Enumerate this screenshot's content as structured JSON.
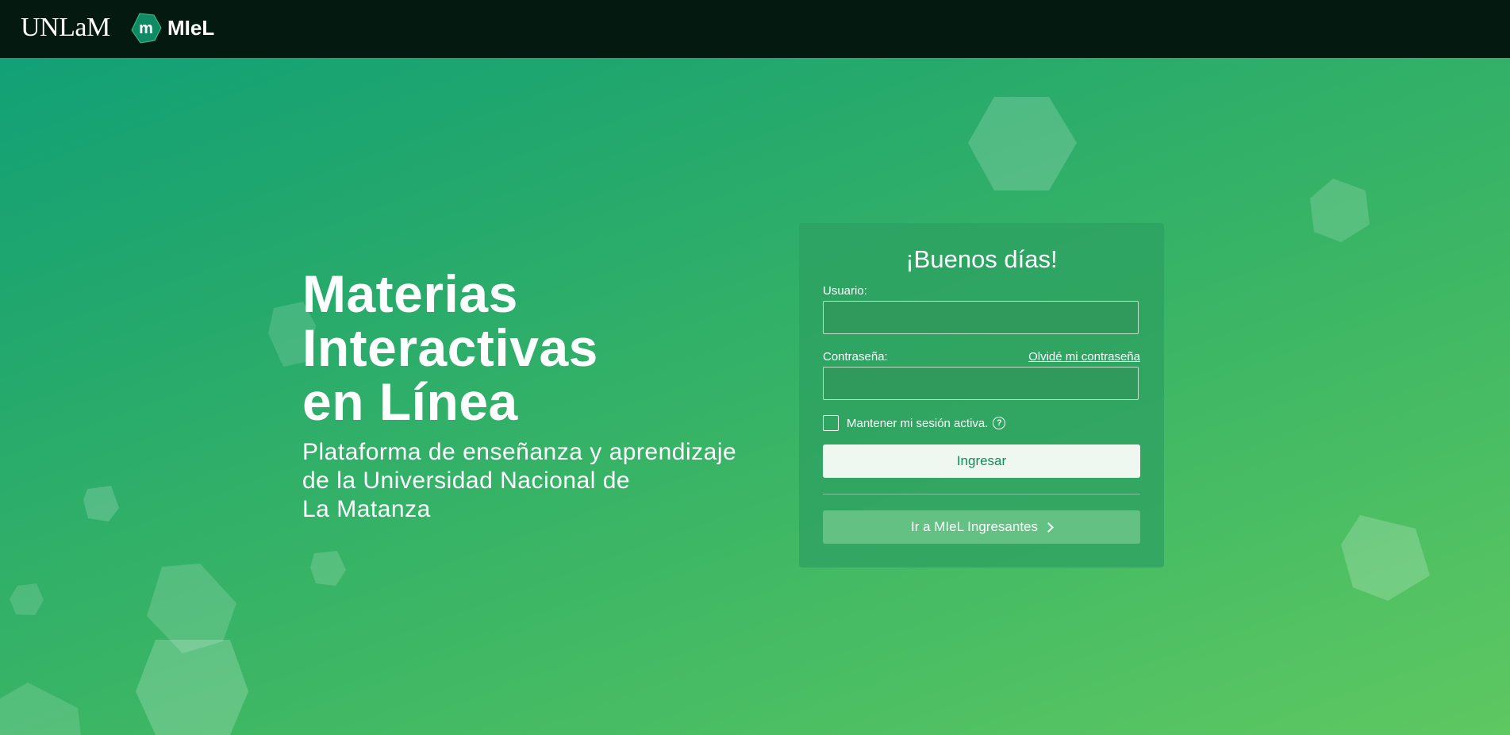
{
  "header": {
    "unlam_logo_text": "UNLaM",
    "miel_mark_letter": "m",
    "miel_text": "MIeL"
  },
  "hero": {
    "title_line1": "Materias",
    "title_line2": "Interactivas",
    "title_line3": "en Línea",
    "subtitle_line1": "Plataforma de enseñanza y aprendizaje",
    "subtitle_line2": "de la Universidad Nacional de",
    "subtitle_line3": "La Matanza"
  },
  "login": {
    "greeting": "¡Buenos días!",
    "username_label": "Usuario:",
    "username_value": "",
    "password_label": "Contraseña:",
    "password_value": "",
    "forgot_link": "Olvidé mi contraseña",
    "remember_label": "Mantener mi sesión activa.",
    "remember_checked": false,
    "help_icon": "?",
    "submit_label": "Ingresar",
    "ingresantes_label": "Ir a MIeL Ingresantes"
  },
  "colors": {
    "topbar": "#041a10",
    "gradient_start": "#0e9f78",
    "gradient_end": "#5ec861",
    "primary_button_bg": "#eef8f0",
    "primary_button_text": "#138a5a"
  },
  "icons": {
    "miel_logo": "hexagon-m-icon",
    "help": "question-circle-icon",
    "chevron": "chevron-right-icon",
    "decor": "hexagon-shape"
  }
}
